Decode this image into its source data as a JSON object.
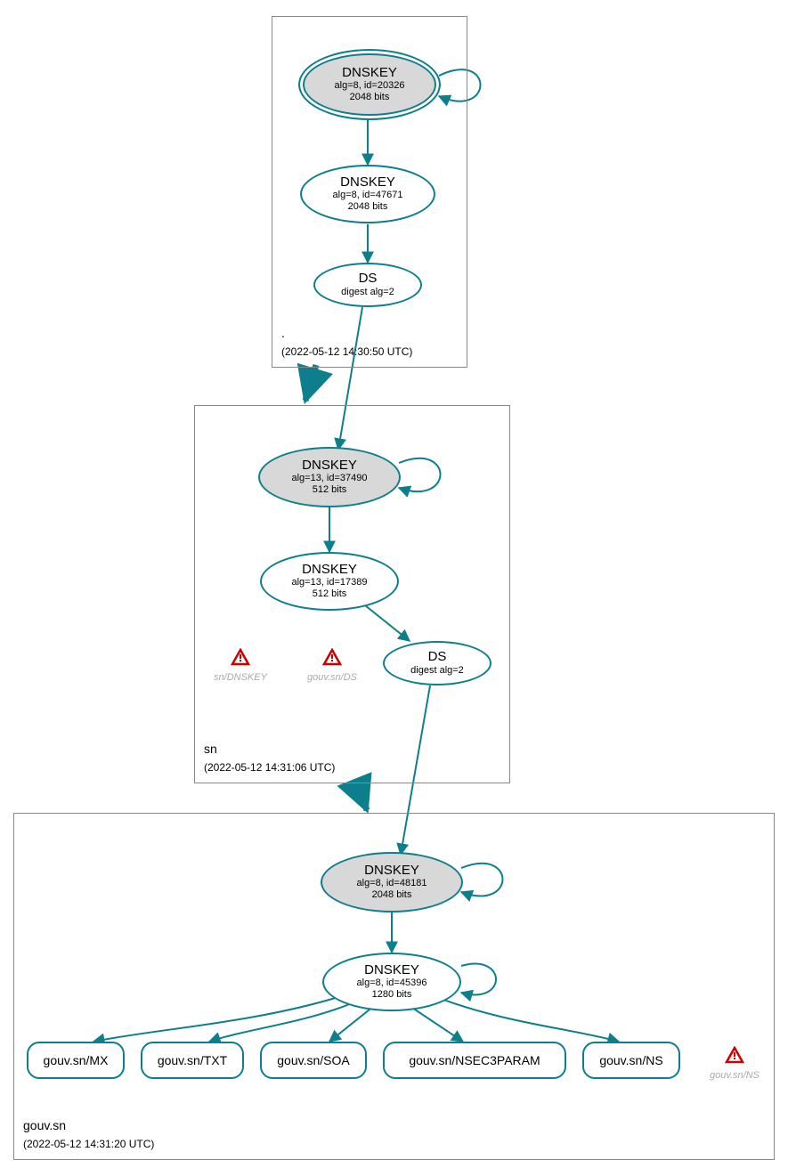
{
  "colors": {
    "stroke": "#0d7f8c",
    "ksk_fill": "#d8d8d8"
  },
  "zones": {
    "root": {
      "name": ".",
      "timestamp": "(2022-05-12 14:30:50 UTC)"
    },
    "sn": {
      "name": "sn",
      "timestamp": "(2022-05-12 14:31:06 UTC)"
    },
    "gouv": {
      "name": "gouv.sn",
      "timestamp": "(2022-05-12 14:31:20 UTC)"
    }
  },
  "nodes": {
    "root_ksk": {
      "title": "DNSKEY",
      "line1": "alg=8, id=20326",
      "line2": "2048 bits"
    },
    "root_zsk": {
      "title": "DNSKEY",
      "line1": "alg=8, id=47671",
      "line2": "2048 bits"
    },
    "root_ds": {
      "title": "DS",
      "line1": "digest alg=2"
    },
    "sn_ksk": {
      "title": "DNSKEY",
      "line1": "alg=13, id=37490",
      "line2": "512 bits"
    },
    "sn_zsk": {
      "title": "DNSKEY",
      "line1": "alg=13, id=17389",
      "line2": "512 bits"
    },
    "sn_ds": {
      "title": "DS",
      "line1": "digest alg=2"
    },
    "gouv_ksk": {
      "title": "DNSKEY",
      "line1": "alg=8, id=48181",
      "line2": "2048 bits"
    },
    "gouv_zsk": {
      "title": "DNSKEY",
      "line1": "alg=8, id=45396",
      "line2": "1280 bits"
    }
  },
  "rrsets": {
    "mx": "gouv.sn/MX",
    "txt": "gouv.sn/TXT",
    "soa": "gouv.sn/SOA",
    "nsec": "gouv.sn/NSEC3PARAM",
    "ns": "gouv.sn/NS"
  },
  "warnings": {
    "sn_dnskey": "sn/DNSKEY",
    "gouv_ds": "gouv.sn/DS",
    "gouv_ns": "gouv.sn/NS"
  }
}
